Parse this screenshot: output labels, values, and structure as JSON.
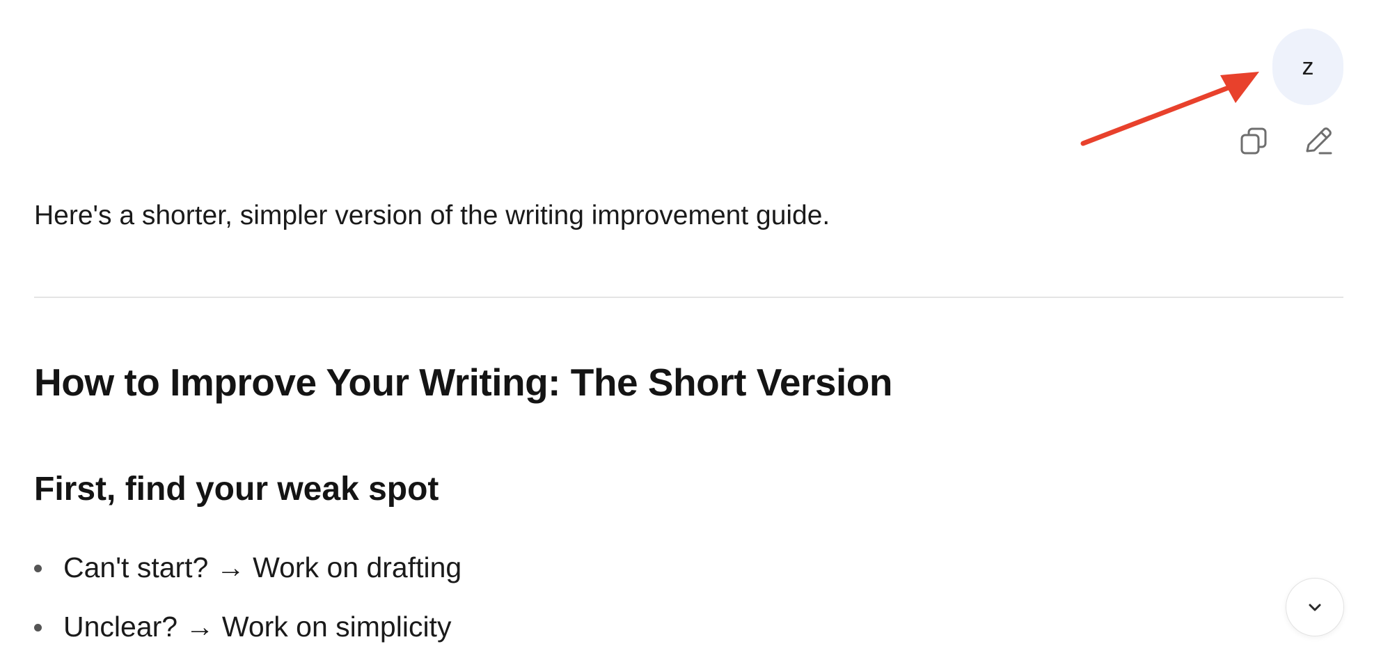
{
  "user_avatar": {
    "initial": "z",
    "background": "#eef2fb"
  },
  "message_actions": {
    "copy_icon": "copy-icon",
    "edit_icon": "pencil-icon"
  },
  "annotation": {
    "arrow_color": "#e8412c"
  },
  "response": {
    "intro": "Here's a shorter, simpler version of the writing improvement guide.",
    "title": "How to Improve Your Writing: The Short Version",
    "section_heading": "First, find your weak spot",
    "bullets": [
      "Can't start? → Work on drafting",
      "Unclear? → Work on simplicity"
    ]
  },
  "scroll_button": {
    "icon": "chevron-down-icon"
  }
}
